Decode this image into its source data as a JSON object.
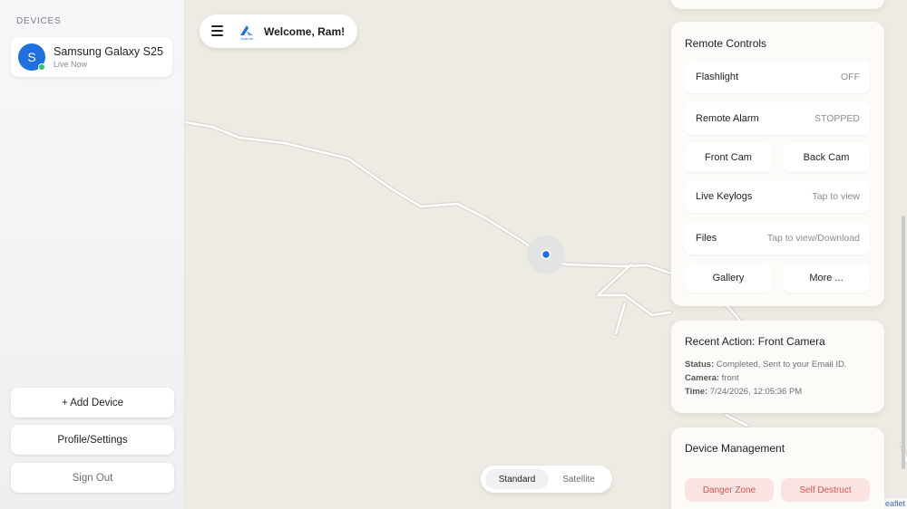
{
  "sidebar": {
    "heading": "DEVICES",
    "device": {
      "avatar_letter": "S",
      "name": "Samsung Galaxy S25",
      "status": "Live Now",
      "online_color": "#2fc36a"
    },
    "buttons": {
      "add_device": "+ Add Device",
      "profile": "Profile/Settings",
      "sign_out": "Sign Out"
    }
  },
  "header": {
    "welcome": "Welcome, Ram!",
    "logo_text": "Android"
  },
  "map": {
    "type_toggle": {
      "standard": "Standard",
      "satellite": "Satellite",
      "selected": "Standard"
    },
    "attribution": "eaflet"
  },
  "remote_controls": {
    "title": "Remote Controls",
    "flashlight": {
      "label": "Flashlight",
      "value": "OFF"
    },
    "alarm": {
      "label": "Remote Alarm",
      "value": "STOPPED"
    },
    "front_cam": "Front Cam",
    "back_cam": "Back Cam",
    "keylogs": {
      "label": "Live Keylogs",
      "value": "Tap to view"
    },
    "files": {
      "label": "Files",
      "value": "Tap to view/Download"
    },
    "gallery": "Gallery",
    "more": "More ..."
  },
  "recent_action": {
    "title": "Recent Action: Front Camera",
    "status_label": "Status:",
    "status_value": "Completed, Sent to your Email ID.",
    "camera_label": "Camera:",
    "camera_value": "front",
    "time_label": "Time:",
    "time_value": "7/24/2026, 12:05:36 PM"
  },
  "device_management": {
    "title": "Device Management",
    "danger_zone": "Danger Zone",
    "self_destruct": "Self Destruct"
  },
  "colors": {
    "accent": "#1f6fe0",
    "danger_bg": "#fbe3e2",
    "danger_text": "#d9534f"
  }
}
